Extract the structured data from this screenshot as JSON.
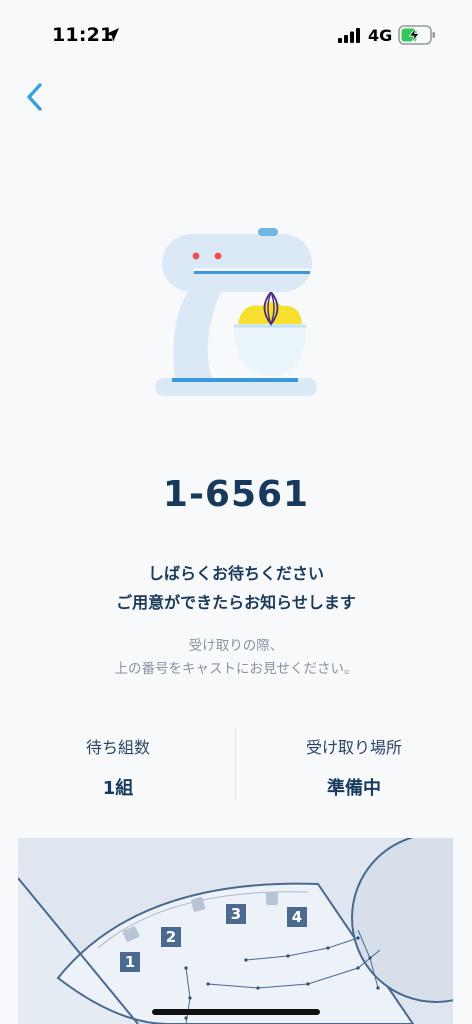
{
  "status_bar": {
    "time": "11:21",
    "network": "4G",
    "location_icon": "location-arrow-icon",
    "signal_icon": "cellular-signal-icon",
    "battery_icon": "battery-charging-icon"
  },
  "nav": {
    "back_icon": "chevron-left-icon"
  },
  "illustration": {
    "icon": "stand-mixer-icon"
  },
  "order": {
    "number": "1-6561"
  },
  "message": {
    "line1": "しばらくお待ちください",
    "line2": "ご用意ができたらお知らせします"
  },
  "note": {
    "line1": "受け取りの際、",
    "line2": "上の番号をキャストにお見せください。"
  },
  "info": {
    "waiting": {
      "label": "待ち組数",
      "value": "1組"
    },
    "pickup": {
      "label": "受け取り場所",
      "value": "準備中"
    }
  },
  "map": {
    "markers": [
      "1",
      "2",
      "3",
      "4"
    ]
  },
  "colors": {
    "accent": "#3aa0dc",
    "title": "#17395c",
    "muted": "#8893a2",
    "map_marker": "#4a6b8f"
  }
}
